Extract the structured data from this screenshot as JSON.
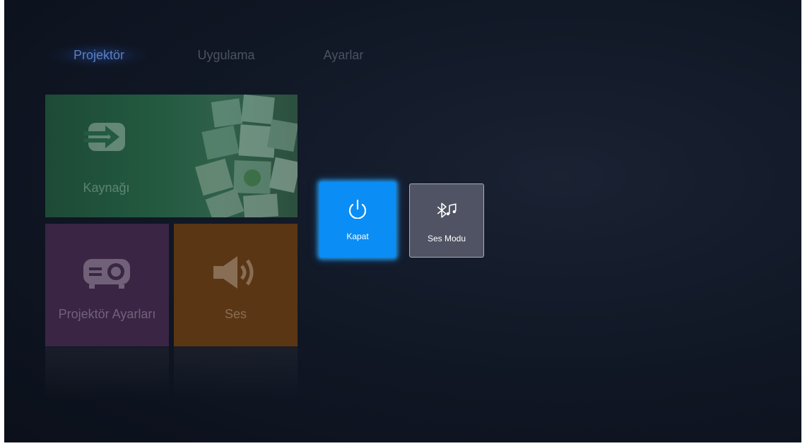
{
  "tabs": [
    {
      "label": "Projektör",
      "active": true
    },
    {
      "label": "Uygulama",
      "active": false
    },
    {
      "label": "Ayarlar",
      "active": false
    }
  ],
  "tiles": {
    "source": {
      "label": "Kaynağı",
      "icon": "input-source-icon"
    },
    "projector_settings": {
      "label": "Projektör Ayarları",
      "icon": "projector-icon"
    },
    "sound": {
      "label": "Ses",
      "icon": "speaker-icon"
    }
  },
  "actions": {
    "power": {
      "label": "Kapat",
      "icon": "power-icon"
    },
    "sound_mode": {
      "label": "Ses Modu",
      "icon": "bluetooth-music-icon"
    }
  },
  "colors": {
    "accent": "#0a8df5",
    "active_tab": "#5a7fbf",
    "source_tile": "#235a40",
    "projector_tile": "#3a2545",
    "sound_tile": "#5a3614"
  }
}
